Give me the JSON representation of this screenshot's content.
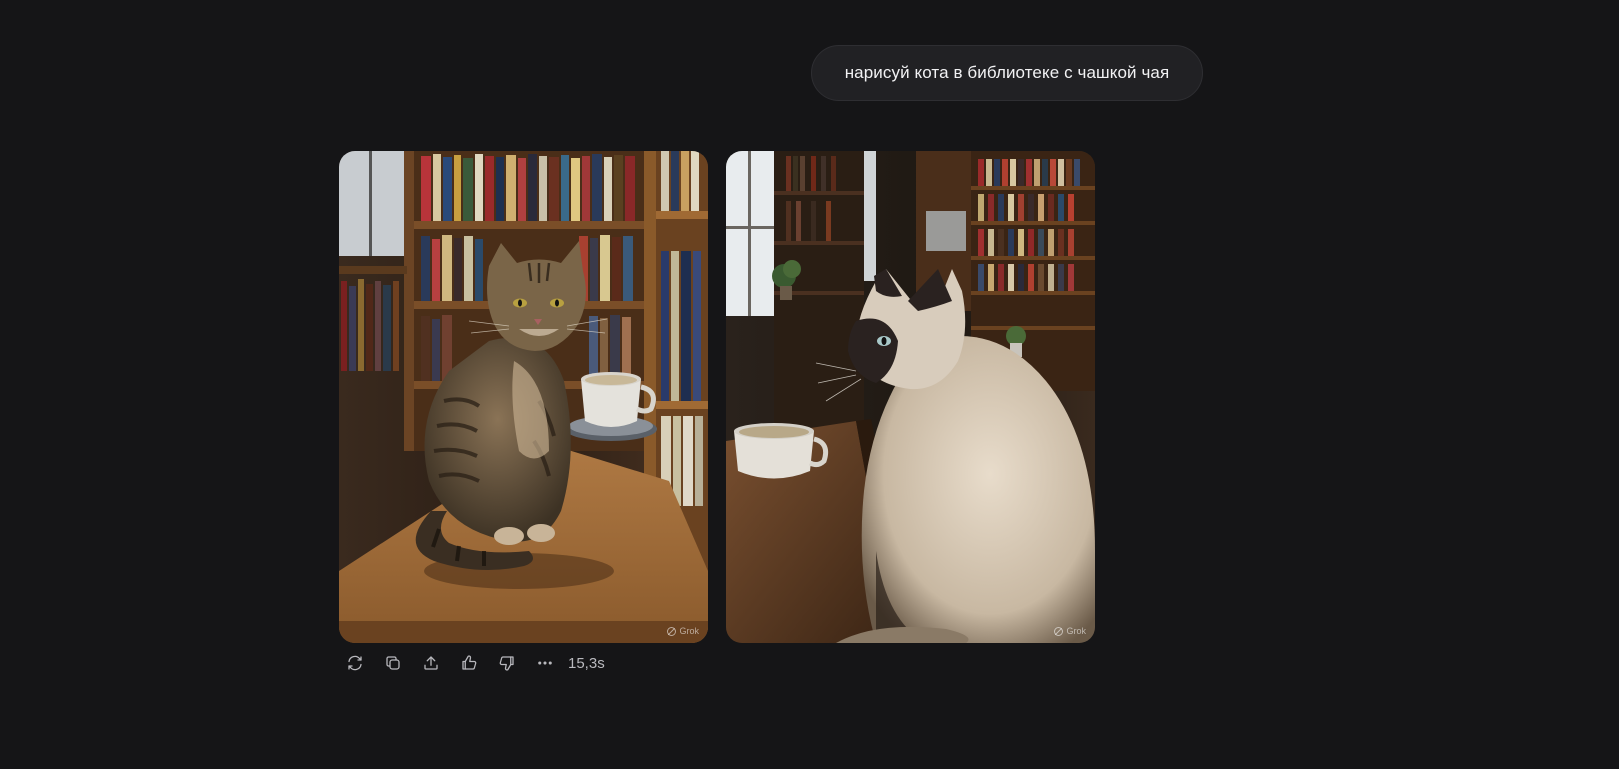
{
  "user_message": "нарисуй кота в библиотеке с чашкой чая",
  "images": [
    {
      "subject": "tabby cat on library desk with teacup",
      "watermark": "Grok"
    },
    {
      "subject": "siamese cat by library window with teacup",
      "watermark": "Grok"
    }
  ],
  "actions": {
    "regenerate_icon": "refresh-icon",
    "copy_icon": "copy-icon",
    "share_icon": "share-icon",
    "like_icon": "thumbs-up-icon",
    "dislike_icon": "thumbs-down-icon",
    "more_icon": "more-icon",
    "response_time": "15,3s"
  }
}
